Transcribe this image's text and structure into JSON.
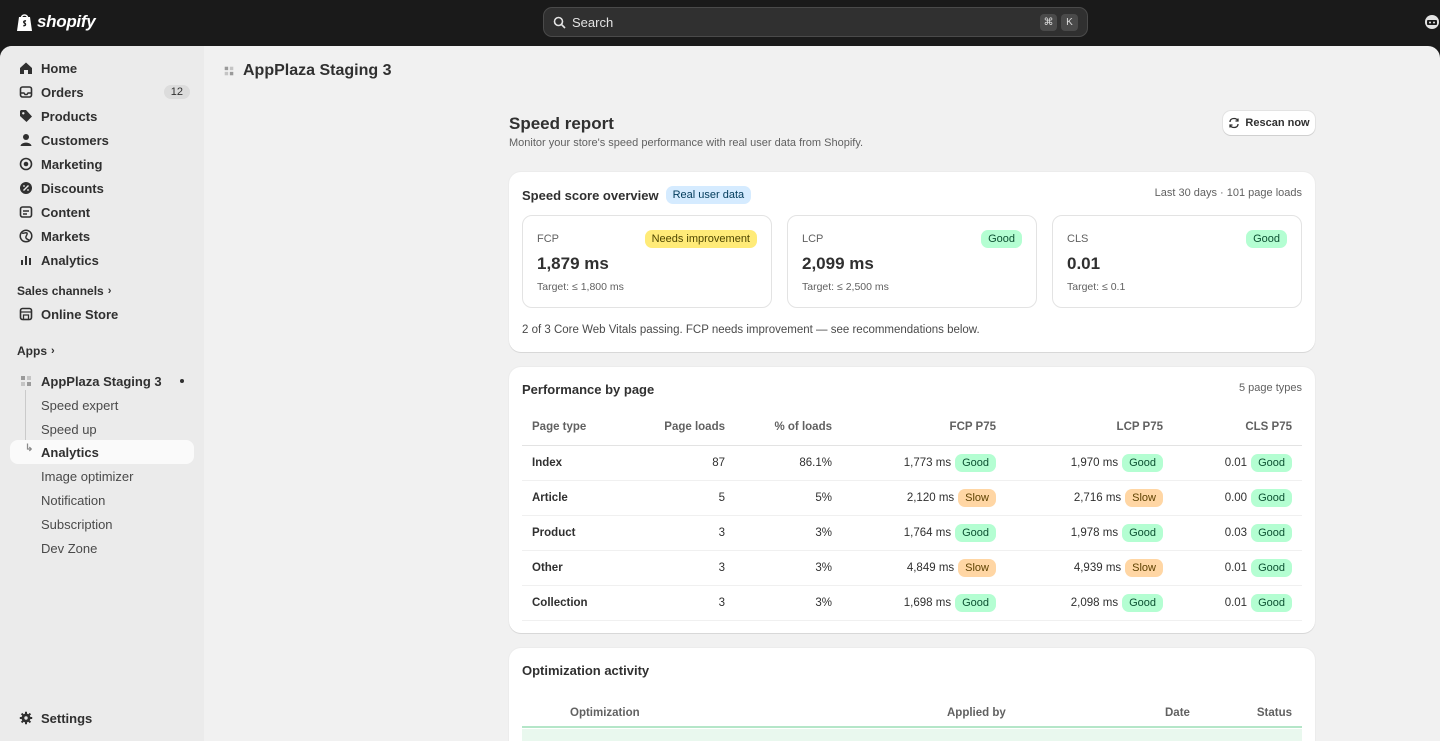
{
  "topbar": {
    "brand": "shopify",
    "search": {
      "label": "Search",
      "shortcut": [
        "⌘",
        "K"
      ]
    }
  },
  "sidebar": {
    "items": [
      {
        "label": "Home",
        "icon": "home-icon"
      },
      {
        "label": "Orders",
        "icon": "inbox-icon",
        "count": "12"
      },
      {
        "label": "Products",
        "icon": "tag-icon"
      },
      {
        "label": "Customers",
        "icon": "person-icon"
      },
      {
        "label": "Marketing",
        "icon": "target-icon"
      },
      {
        "label": "Discounts",
        "icon": "discount-icon"
      },
      {
        "label": "Content",
        "icon": "content-icon"
      },
      {
        "label": "Markets",
        "icon": "globe-icon"
      },
      {
        "label": "Analytics",
        "icon": "bar-chart-icon"
      }
    ],
    "sales_channels_label": "Sales channels",
    "online_store": "Online Store",
    "apps_label": "Apps",
    "app_name": "AppPlaza Staging 3",
    "app_subitems": [
      "Speed expert",
      "Speed up",
      "Analytics",
      "Image optimizer",
      "Notification",
      "Subscription",
      "Dev Zone"
    ],
    "settings": "Settings"
  },
  "page": {
    "title": "AppPlaza Staging 3",
    "report_title": "Speed report",
    "report_subtitle": "Monitor your store's speed performance with real user data from Shopify.",
    "rescan_label": "Rescan now"
  },
  "overview": {
    "title": "Speed score overview",
    "badge": "Real user data",
    "meta": "Last 30 days · 101 page loads",
    "metrics": [
      {
        "label": "FCP",
        "status": "Needs improvement",
        "value": "1,879 ms",
        "target": "Target: ≤ 1,800 ms"
      },
      {
        "label": "LCP",
        "status": "Good",
        "value": "2,099 ms",
        "target": "Target: ≤ 2,500 ms"
      },
      {
        "label": "CLS",
        "status": "Good",
        "value": "0.01",
        "target": "Target: ≤ 0.1"
      }
    ],
    "summary": "2 of 3 Core Web Vitals passing. FCP needs improvement — see recommendations below."
  },
  "performance": {
    "title": "Performance by page",
    "meta": "5 page types",
    "headers": [
      "Page type",
      "Page loads",
      "% of loads",
      "FCP P75",
      "LCP P75",
      "CLS P75"
    ],
    "rows": [
      {
        "type": "Index",
        "loads": "87",
        "pct": "86.1%",
        "fcp": "1,773 ms",
        "fcp_status": "Good",
        "lcp": "1,970 ms",
        "lcp_status": "Good",
        "cls": "0.01",
        "cls_status": "Good"
      },
      {
        "type": "Article",
        "loads": "5",
        "pct": "5%",
        "fcp": "2,120 ms",
        "fcp_status": "Slow",
        "lcp": "2,716 ms",
        "lcp_status": "Slow",
        "cls": "0.00",
        "cls_status": "Good"
      },
      {
        "type": "Product",
        "loads": "3",
        "pct": "3%",
        "fcp": "1,764 ms",
        "fcp_status": "Good",
        "lcp": "1,978 ms",
        "lcp_status": "Good",
        "cls": "0.03",
        "cls_status": "Good"
      },
      {
        "type": "Other",
        "loads": "3",
        "pct": "3%",
        "fcp": "4,849 ms",
        "fcp_status": "Slow",
        "lcp": "4,939 ms",
        "lcp_status": "Slow",
        "cls": "0.01",
        "cls_status": "Good"
      },
      {
        "type": "Collection",
        "loads": "3",
        "pct": "3%",
        "fcp": "1,698 ms",
        "fcp_status": "Good",
        "lcp": "2,098 ms",
        "lcp_status": "Good",
        "cls": "0.01",
        "cls_status": "Good"
      }
    ]
  },
  "optimization": {
    "title": "Optimization activity",
    "headers": [
      "Optimization",
      "Applied by",
      "Date",
      "Status"
    ]
  }
}
